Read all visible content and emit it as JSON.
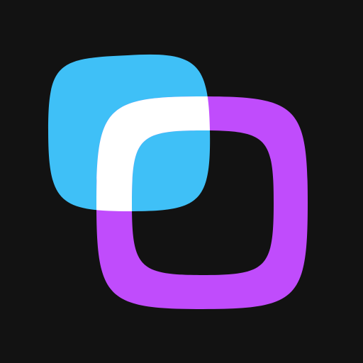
{
  "app_icon": {
    "icon_name": "overlapping-squircles-logo-icon",
    "colors": {
      "background": "#121212",
      "blue_shape": "#3FC0F7",
      "purple_ring": "#C04CFC",
      "overlap_white": "#FFFFFF"
    }
  }
}
